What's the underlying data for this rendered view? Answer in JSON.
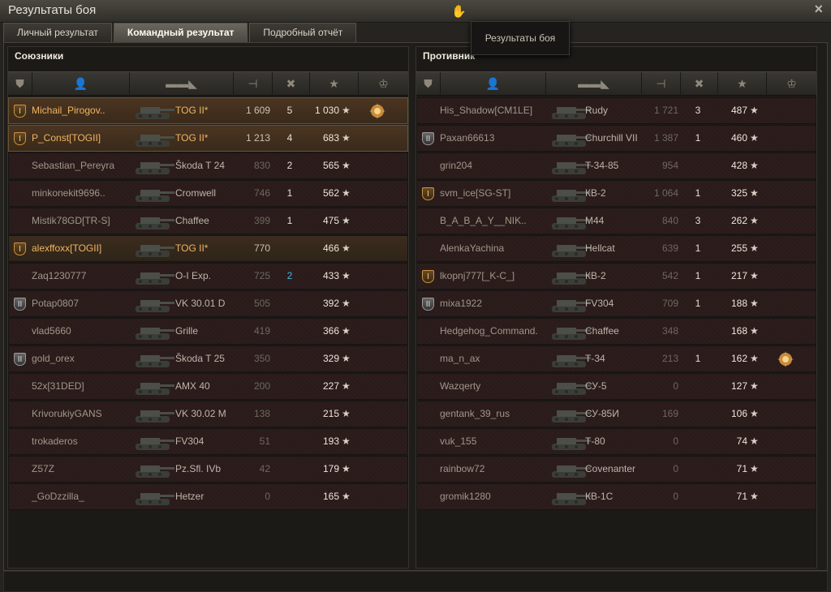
{
  "window": {
    "title": "Результаты боя",
    "close": "×"
  },
  "tabs": [
    {
      "label": "Личный результат",
      "active": false
    },
    {
      "label": "Командный результат",
      "active": true
    },
    {
      "label": "Подробный отчёт",
      "active": false
    }
  ],
  "tooltip": "Результаты боя",
  "teams": {
    "allies": {
      "title": "Союзники",
      "rows": [
        {
          "badge": "I",
          "name": "Michail_Pirogov..",
          "vehicle": "TOG II*",
          "damage": "1 609",
          "kills": "5",
          "xp": "1 030",
          "hl": "plat",
          "medal": true
        },
        {
          "badge": "I",
          "name": "P_Const[TOGII]",
          "vehicle": "TOG II*",
          "damage": "1 213",
          "kills": "4",
          "xp": "683",
          "hl": "plat"
        },
        {
          "name": "Sebastian_Pereyra",
          "vehicle": "Škoda T 24",
          "damage": "830",
          "kills": "2",
          "xp": "565"
        },
        {
          "name": "minkonekit9696..",
          "vehicle": "Cromwell",
          "damage": "746",
          "kills": "1",
          "xp": "562"
        },
        {
          "name": "Mistik78GD[TR-S]",
          "vehicle": "Chaffee",
          "damage": "399",
          "kills": "1",
          "xp": "475"
        },
        {
          "badge": "I",
          "name": "alexffoxx[TOGII]",
          "vehicle": "TOG II*",
          "damage": "770",
          "kills": "",
          "xp": "466",
          "hl": "hl"
        },
        {
          "name": "Zaq1230777",
          "vehicle": "O-I Exp.",
          "damage": "725",
          "kills": "2",
          "xp": "433",
          "killsBlue": true
        },
        {
          "badge": "II",
          "name": "Potap0807",
          "vehicle": "VK 30.01 D",
          "damage": "505",
          "kills": "",
          "xp": "392"
        },
        {
          "name": "vlad5660",
          "vehicle": "Grille",
          "damage": "419",
          "kills": "",
          "xp": "366"
        },
        {
          "badge": "II",
          "name": "gold_orex",
          "vehicle": "Škoda T 25",
          "damage": "350",
          "kills": "",
          "xp": "329"
        },
        {
          "name": "52x[31DED]",
          "vehicle": "AMX 40",
          "damage": "200",
          "kills": "",
          "xp": "227"
        },
        {
          "name": "KrivorukiyGANS",
          "vehicle": "VK 30.02 M",
          "damage": "138",
          "kills": "",
          "xp": "215"
        },
        {
          "name": "trokaderos",
          "vehicle": "FV304",
          "damage": "51",
          "kills": "",
          "xp": "193"
        },
        {
          "name": "Z57Z",
          "vehicle": "Pz.Sfl. IVb",
          "damage": "42",
          "kills": "",
          "xp": "179"
        },
        {
          "name": "_GoDzzilla_",
          "vehicle": "Hetzer",
          "damage": "0",
          "kills": "",
          "xp": "165"
        }
      ]
    },
    "enemies": {
      "title": "Противник",
      "rows": [
        {
          "name": "His_Shadow[CM1LE]",
          "vehicle": "Rudy",
          "damage": "1 721",
          "kills": "3",
          "xp": "487"
        },
        {
          "badge": "II",
          "name": "Paxan66613",
          "vehicle": "Churchill VII",
          "damage": "1 387",
          "kills": "1",
          "xp": "460"
        },
        {
          "name": "grin204",
          "vehicle": "T-34-85",
          "damage": "954",
          "kills": "",
          "xp": "428"
        },
        {
          "badge": "I",
          "name": "svm_ice[SG-ST]",
          "vehicle": "КВ-2",
          "damage": "1 064",
          "kills": "1",
          "xp": "325"
        },
        {
          "name": "B_A_B_A_Y__NIK..",
          "vehicle": "M44",
          "damage": "840",
          "kills": "3",
          "xp": "262"
        },
        {
          "name": "AlenkaYachina",
          "vehicle": "Hellcat",
          "damage": "639",
          "kills": "1",
          "xp": "255"
        },
        {
          "badge": "I",
          "name": "lkopnj777[_K-C_]",
          "vehicle": "КВ-2",
          "damage": "542",
          "kills": "1",
          "xp": "217"
        },
        {
          "badge": "II",
          "name": "mixa1922",
          "vehicle": "FV304",
          "damage": "709",
          "kills": "1",
          "xp": "188"
        },
        {
          "name": "Hedgehog_Command..",
          "vehicle": "Chaffee",
          "damage": "348",
          "kills": "",
          "xp": "168"
        },
        {
          "name": "ma_n_ax",
          "vehicle": "Т-34",
          "damage": "213",
          "kills": "1",
          "xp": "162",
          "medal": true
        },
        {
          "name": "Wazqerty",
          "vehicle": "СУ-5",
          "damage": "0",
          "kills": "",
          "xp": "127"
        },
        {
          "name": "gentank_39_rus",
          "vehicle": "СУ-85И",
          "damage": "169",
          "kills": "",
          "xp": "106"
        },
        {
          "name": "vuk_155",
          "vehicle": "Т-80",
          "damage": "0",
          "kills": "",
          "xp": "74"
        },
        {
          "name": "rainbow72",
          "vehicle": "Covenanter",
          "damage": "0",
          "kills": "",
          "xp": "71"
        },
        {
          "name": "gromik1280",
          "vehicle": "КВ-1С",
          "damage": "0",
          "kills": "",
          "xp": "71"
        }
      ]
    }
  },
  "colors": {
    "highlight": "#f0b462",
    "kills_blue": "#44b7e4"
  },
  "icons": [
    "rank-icon",
    "player-icon",
    "tank-icon",
    "damage-icon",
    "kills-icon",
    "xp-star-icon",
    "medal-icon",
    "close-icon"
  ]
}
